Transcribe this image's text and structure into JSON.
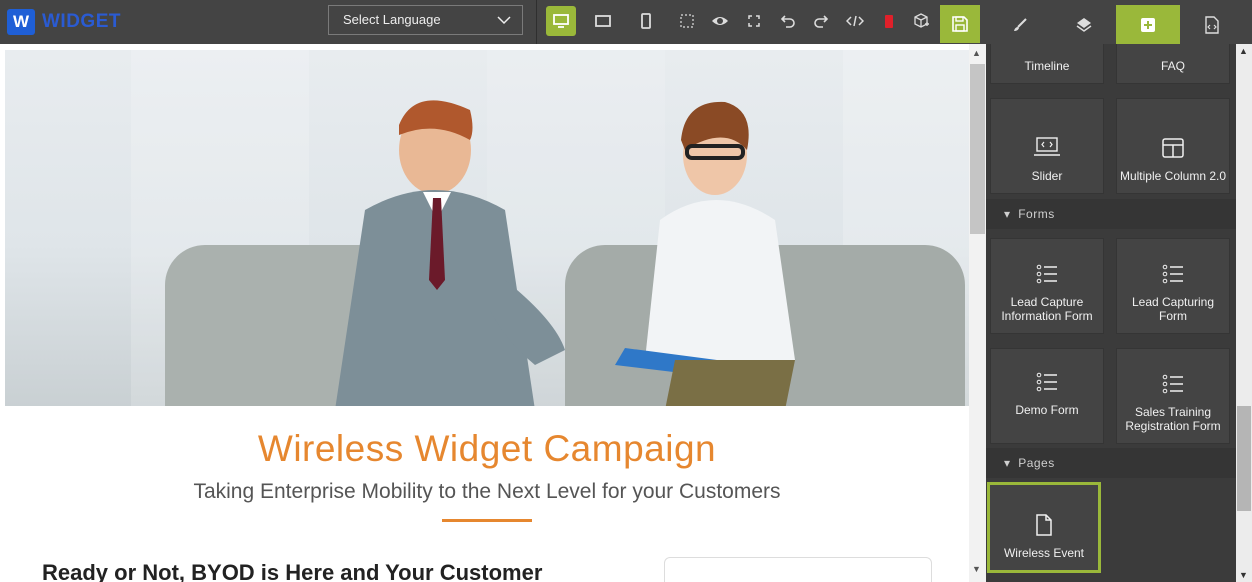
{
  "app": {
    "logo_letter": "W",
    "logo_text": "WIDGET"
  },
  "toolbar": {
    "language_placeholder": "Select Language",
    "icons": [
      "desktop-view-icon",
      "tablet-view-icon",
      "mobile-view-icon",
      "select-area-icon",
      "preview-eye-icon",
      "fullscreen-icon",
      "undo-icon",
      "redo-icon",
      "code-view-icon",
      "delete-icon",
      "add-block-icon",
      "save-icon"
    ]
  },
  "panel_tabs": [
    "style-manager-tab",
    "layer-manager-tab",
    "blocks-tab",
    "import-code-tab"
  ],
  "canvas": {
    "headline": "Wireless Widget Campaign",
    "subheadline": "Taking Enterprise Mobility to the Next Level for your Customers",
    "section_heading": "Ready or Not, BYOD is Here and Your Customer"
  },
  "blocks_panel": {
    "top_blocks": [
      {
        "label": "Timeline"
      },
      {
        "label": "FAQ"
      },
      {
        "label": "Slider",
        "icon": "slider-icon"
      },
      {
        "label": "Multiple Column 2.0",
        "icon": "columns-icon"
      }
    ],
    "categories": [
      {
        "name": "Forms",
        "blocks": [
          {
            "label": "Lead Capture Information Form",
            "icon": "form-list-icon"
          },
          {
            "label": "Lead Capturing Form",
            "icon": "form-list-icon"
          },
          {
            "label": "Demo Form",
            "icon": "form-list-icon"
          },
          {
            "label": "Sales Training Registration Form",
            "icon": "form-list-icon"
          }
        ]
      },
      {
        "name": "Pages",
        "blocks": [
          {
            "label": "Wireless Event",
            "icon": "page-icon",
            "selected": true
          }
        ]
      }
    ]
  },
  "colors": {
    "accent_green": "#9ab83a",
    "headline_orange": "#e6872f",
    "logo_blue": "#1f5fd6"
  }
}
